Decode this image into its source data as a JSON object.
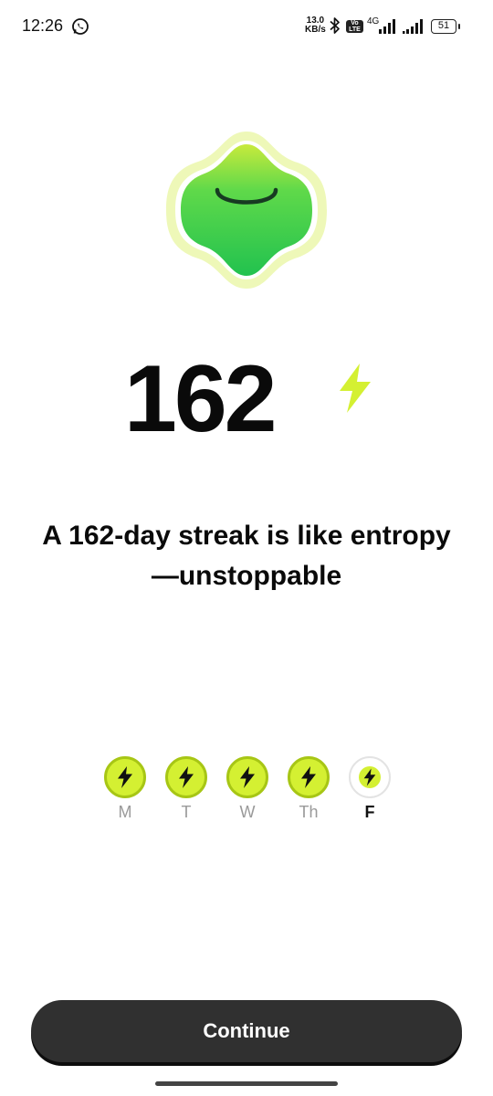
{
  "status_bar": {
    "time": "12:26",
    "net_speed_value": "13.0",
    "net_speed_unit": "KB/s",
    "volte_label": "Vo LTE",
    "network_type": "4G",
    "battery_level": "51",
    "icons": [
      "whatsapp-icon",
      "bluetooth-icon",
      "volte-icon",
      "signal-icon",
      "signal-icon",
      "battery-icon"
    ]
  },
  "streak": {
    "count": "162",
    "message": "A 162-day streak is like entropy—unstoppable",
    "icon": "bolt-icon"
  },
  "week": {
    "days": [
      {
        "label": "M",
        "completed": true
      },
      {
        "label": "T",
        "completed": true
      },
      {
        "label": "W",
        "completed": true
      },
      {
        "label": "Th",
        "completed": true
      },
      {
        "label": "F",
        "completed": false,
        "current": true
      }
    ]
  },
  "actions": {
    "continue_label": "Continue"
  },
  "colors": {
    "accent": "#d4f032",
    "accent_border": "#a7c615",
    "mascot_green": "#2fcf52",
    "button_bg": "#303030"
  }
}
